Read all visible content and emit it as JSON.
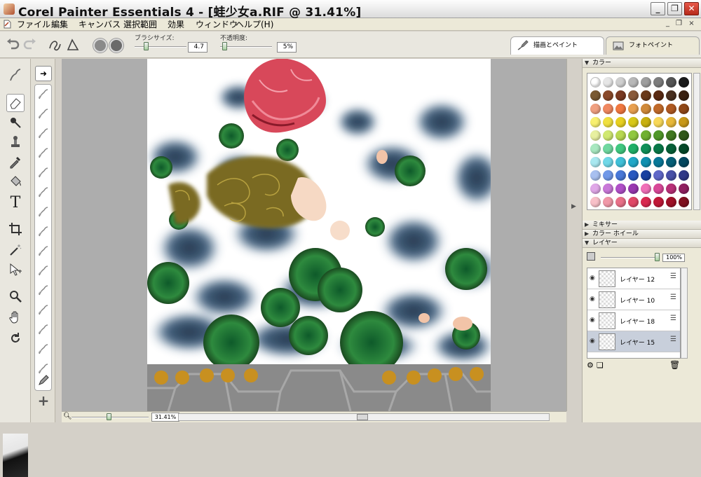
{
  "window": {
    "title": "Corel Painter Essentials 4 - [蛙少女a.RIF @ 31.41%]",
    "minimize": "_",
    "restore": "❐",
    "close": "✕"
  },
  "menu": {
    "items": [
      "ファイル",
      "編集",
      "キャンバス",
      "選択範囲",
      "効果",
      "ウィンドウ",
      "ヘルプ(H)"
    ],
    "mdi_min": "_",
    "mdi_restore": "❐",
    "mdi_close": "×"
  },
  "propbar": {
    "brush_size_label": "ブラシサイズ:",
    "brush_size_value": "4.7",
    "brush_size_level": 0.2,
    "opacity_label": "不透明度:",
    "opacity_value": "5%",
    "opacity_level": 0.05
  },
  "tabs": {
    "paint": "描画とペイント",
    "photo": "フォトペイント"
  },
  "status": {
    "zoom": "31.41%"
  },
  "panels": {
    "color": "カラー",
    "mixer": "ミキサー",
    "color_wheel": "カラー ホイール",
    "layers": "レイヤー",
    "layer_opacity": "100%",
    "layer_opacity_level": 1.0,
    "layer_list": [
      "レイヤー 12",
      "レイヤー 10",
      "レイヤー 18",
      "レイヤー 15"
    ],
    "selected_layer": 3
  },
  "color_palette": [
    [
      "#ffffff",
      "#e6e6e6",
      "#cfcfcf",
      "#b8b8b8",
      "#9e9e9e",
      "#7d7d7d",
      "#555555",
      "#1a1a1a"
    ],
    [
      "#7a5a32",
      "#8a4a2a",
      "#7a3a22",
      "#8a5a3a",
      "#6a3a1a",
      "#5a2a12",
      "#4a3020",
      "#3a2010"
    ],
    [
      "#f0a080",
      "#f08860",
      "#f07840",
      "#e8a050",
      "#d08a3a",
      "#c06a2a",
      "#b05a22",
      "#904818"
    ],
    [
      "#f8f070",
      "#f0e040",
      "#e8d020",
      "#d8c818",
      "#c8b010",
      "#f8d858",
      "#e8b838",
      "#c89818"
    ],
    [
      "#e8f0a0",
      "#d0e870",
      "#b8d850",
      "#90c840",
      "#70b030",
      "#509828",
      "#407820",
      "#305818"
    ],
    [
      "#a8e8c0",
      "#70d8a0",
      "#40c880",
      "#20b068",
      "#109058",
      "#087848",
      "#066038",
      "#044828"
    ],
    [
      "#a8e8f0",
      "#70d8e8",
      "#40c0d8",
      "#20a8c8",
      "#1090b0",
      "#087898",
      "#066078",
      "#044860"
    ],
    [
      "#a8c0f0",
      "#7098e8",
      "#4878d8",
      "#2858c0",
      "#1840a0",
      "#6068c8",
      "#4850a8",
      "#303888"
    ],
    [
      "#e0a8e8",
      "#c878d8",
      "#b050c8",
      "#9838b0",
      "#f070b8",
      "#d84898",
      "#b83078",
      "#902060"
    ],
    [
      "#f8c0c8",
      "#f098a8",
      "#e87088",
      "#e04868",
      "#d82850",
      "#c01838",
      "#a01028",
      "#801020"
    ]
  ]
}
